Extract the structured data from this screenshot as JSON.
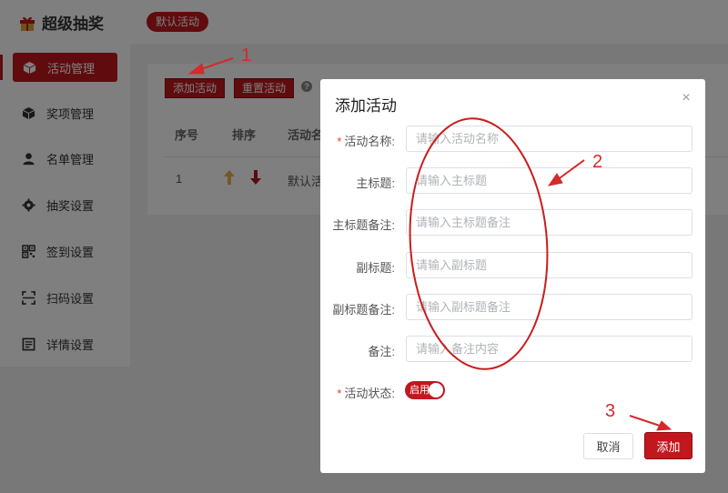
{
  "app": {
    "title": "超级抽奖",
    "active_tag": "默认活动"
  },
  "sidebar": {
    "items": [
      {
        "label": "活动管理",
        "icon": "cube-icon",
        "active": true
      },
      {
        "label": "奖项管理",
        "icon": "cube-icon"
      },
      {
        "label": "名单管理",
        "icon": "user-icon"
      },
      {
        "label": "抽奖设置",
        "icon": "gear-icon"
      },
      {
        "label": "签到设置",
        "icon": "qrcode-icon"
      },
      {
        "label": "扫码设置",
        "icon": "scan-icon"
      },
      {
        "label": "详情设置",
        "icon": "list-icon"
      }
    ]
  },
  "toolbar": {
    "add_label": "添加活动",
    "reset_label": "重置活动",
    "help": "?"
  },
  "table": {
    "headers": [
      "序号",
      "排序",
      "活动名"
    ],
    "rows": [
      {
        "index": "1",
        "name": "默认活"
      }
    ]
  },
  "modal": {
    "title": "添加活动",
    "close": "×",
    "fields": [
      {
        "label": "活动名称:",
        "required": true,
        "placeholder": "请输入活动名称"
      },
      {
        "label": "主标题:",
        "placeholder": "请输入主标题"
      },
      {
        "label": "主标题备注:",
        "placeholder": "请输入主标题备注"
      },
      {
        "label": "副标题:",
        "placeholder": "请输入副标题"
      },
      {
        "label": "副标题备注:",
        "placeholder": "请输入副标题备注"
      },
      {
        "label": "备注:",
        "placeholder": "请输入备注内容"
      }
    ],
    "status": {
      "label": "活动状态:",
      "required": true,
      "toggle_text": "启用",
      "on": true
    },
    "cancel_label": "取消",
    "submit_label": "添加"
  },
  "annotations": {
    "numbers": [
      "1",
      "2",
      "3"
    ]
  },
  "colors": {
    "brand": "#c0181e",
    "annotation": "#d42a2a"
  }
}
